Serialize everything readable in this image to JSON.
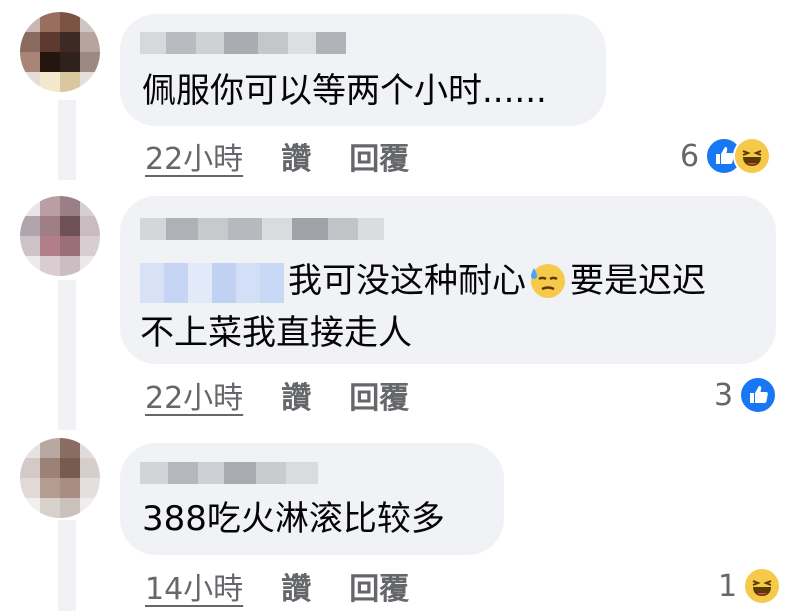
{
  "comments": [
    {
      "text_lines": [
        "佩服你可以等两个小时......"
      ],
      "time": "22小時",
      "like_label": "讚",
      "reply_label": "回覆",
      "reaction_count": "6",
      "reactions": [
        "like",
        "haha"
      ]
    },
    {
      "text_lines": [
        "我可没这种耐心",
        "要是迟迟",
        "不上菜我直接走人"
      ],
      "inline_emoji": "sweat-emoji",
      "time": "22小時",
      "like_label": "讚",
      "reply_label": "回覆",
      "reaction_count": "3",
      "reactions": [
        "like"
      ]
    },
    {
      "text_lines": [
        "388吃火淋滚比较多"
      ],
      "time": "14小時",
      "like_label": "讚",
      "reply_label": "回覆",
      "reaction_count": "1",
      "reactions": [
        "haha"
      ]
    }
  ],
  "colors": {
    "bubble": "#f0f2f5",
    "meta_text": "#65676b",
    "like_blue": "#1877f2",
    "haha_yellow": "#f7c94b"
  }
}
